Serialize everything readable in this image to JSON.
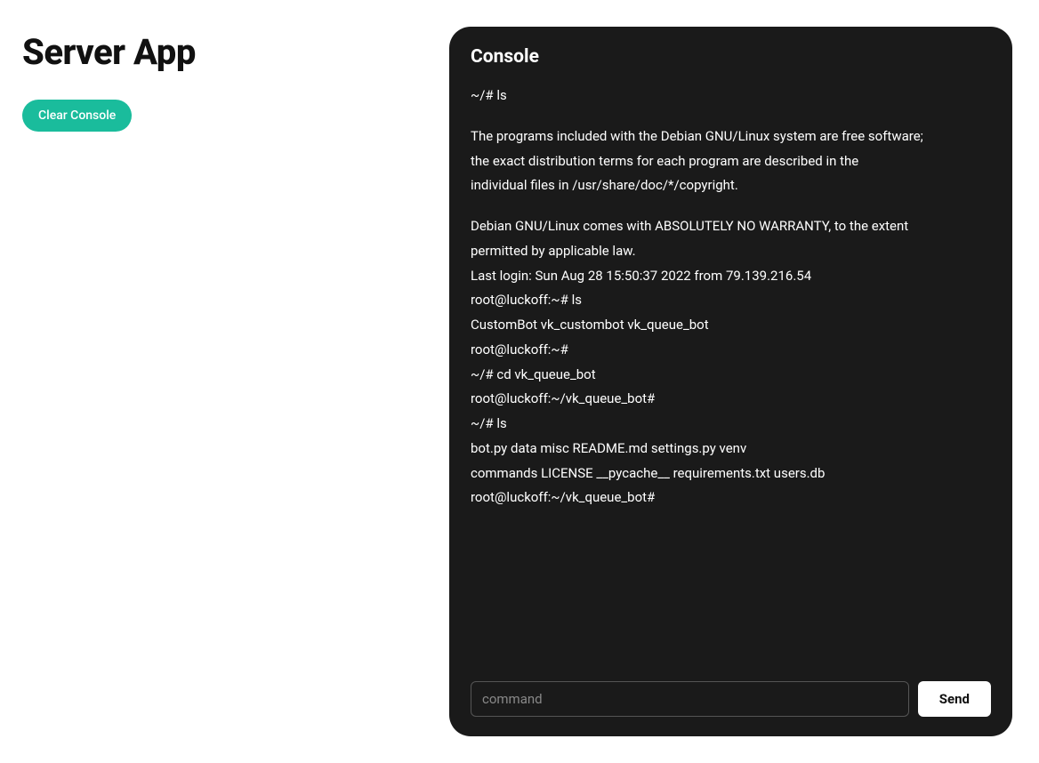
{
  "header": {
    "title": "Server App",
    "clear_button": "Clear Console"
  },
  "console": {
    "title": "Console",
    "blocks": [
      {
        "lines": [
          "~/# ls"
        ]
      },
      {
        "lines": [
          "The programs included with the Debian GNU/Linux system are free software;",
          "the exact distribution terms for each program are described in the",
          "individual files in /usr/share/doc/*/copyright."
        ]
      },
      {
        "lines": [
          "Debian GNU/Linux comes with ABSOLUTELY NO WARRANTY, to the extent",
          "permitted by applicable law.",
          "Last login: Sun Aug 28 15:50:37 2022 from 79.139.216.54",
          "root@luckoff:~# ls",
          "CustomBot vk_custombot vk_queue_bot",
          "root@luckoff:~#",
          "~/# cd vk_queue_bot",
          "root@luckoff:~/vk_queue_bot#",
          "~/# ls",
          "bot.py data misc README.md settings.py venv",
          "commands LICENSE __pycache__ requirements.txt users.db",
          "root@luckoff:~/vk_queue_bot#"
        ]
      }
    ],
    "input_placeholder": "command",
    "send_button": "Send"
  }
}
